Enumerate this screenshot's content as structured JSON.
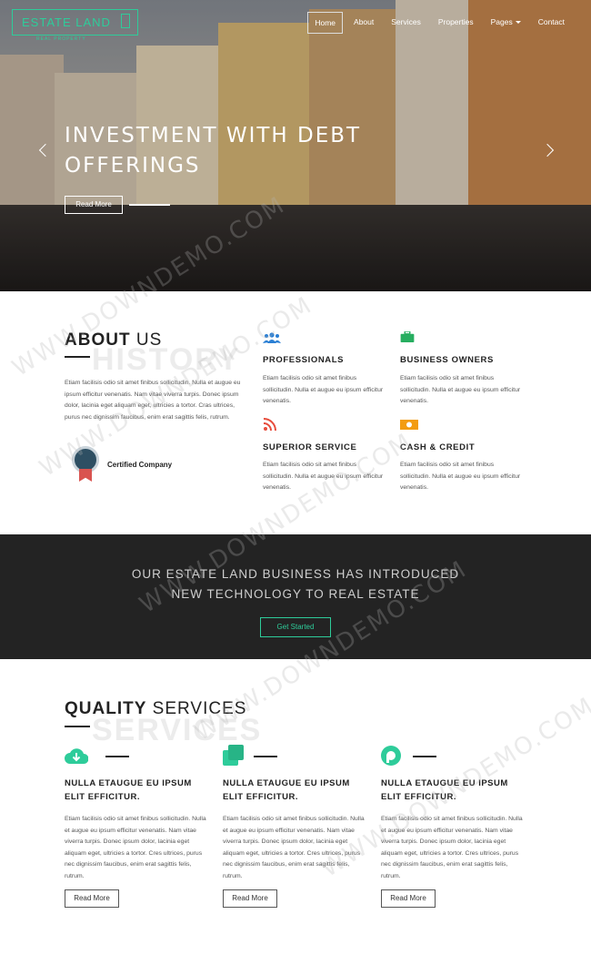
{
  "header": {
    "logo": "ESTATE LAND",
    "logo_sub": "REAL PROPERTY",
    "nav": [
      "Home",
      "About",
      "Services",
      "Properties",
      "Pages",
      "Contact"
    ]
  },
  "hero": {
    "title": "INVESTMENT WITH DEBT OFFERINGS",
    "button": "Read More"
  },
  "about": {
    "title_bold": "ABOUT",
    "title_light": "US",
    "ghost": "HISTORY",
    "text": "Etiam facilisis odio sit amet finibus sollicitudin. Nulla et augue eu ipsum efficitur venenatis. Nam vitae viverra turpis. Donec ipsum dolor, lacinia eget aliquam eget, ultricies a tortor. Cras ultrices, purus nec dignissim faucibus, enim erat sagittis felis, rutrum.",
    "certified": "Certified Company",
    "features": [
      {
        "title": "PROFESSIONALS",
        "icon": "users-icon",
        "text": "Etiam facilisis odio sit amet finibus sollicitudin. Nulla et augue eu ipsum efficitur venenatis."
      },
      {
        "title": "BUSINESS OWNERS",
        "icon": "briefcase-icon",
        "text": "Etiam facilisis odio sit amet finibus sollicitudin. Nulla et augue eu ipsum efficitur venenatis."
      },
      {
        "title": "SUPERIOR SERVICE",
        "icon": "rss-icon",
        "text": "Etiam facilisis odio sit amet finibus sollicitudin. Nulla et augue eu ipsum efficitur venenatis."
      },
      {
        "title": "CASH & CREDIT",
        "icon": "cash-icon",
        "text": "Etiam facilisis odio sit amet finibus sollicitudin. Nulla et augue eu ipsum efficitur venenatis."
      }
    ]
  },
  "cta": {
    "line1": "OUR ESTATE LAND BUSINESS HAS INTRODUCED",
    "line2": "NEW TECHNOLOGY TO REAL ESTATE",
    "button": "Get Started"
  },
  "services": {
    "title_bold": "QUALITY",
    "title_light": "SERVICES",
    "ghost": "SERVICES",
    "items": [
      {
        "icon": "cloud-download-icon",
        "title": "NULLA ETAUGUE EU IPSUM ELIT EFFICITUR.",
        "text": "Etiam facilisis odio sit amet finibus sollicitudin. Nulla et augue eu ipsum efficitur venenatis. Nam vitae viverra turpis. Donec ipsum dolor, lacinia eget aliquam eget, ultricies a tortor. Cres ultrices, purus nec dignissim faucibus, enim erat sagittis felis, rutrum.",
        "button": "Read More"
      },
      {
        "icon": "copy-icon",
        "title": "NULLA ETAUGUE EU IPSUM ELIT EFFICITUR.",
        "text": "Etiam facilisis odio sit amet finibus sollicitudin. Nulla et augue eu ipsum efficitur venenatis. Nam vitae viverra turpis. Donec ipsum dolor, lacinia eget aliquam eget, ultricies a tortor. Cres ultrices, purus nec dignissim faucibus, enim erat sagittis felis, rutrum.",
        "button": "Read More"
      },
      {
        "icon": "circle-play-icon",
        "title": "NULLA ETAUGUE EU IPSUM ELIT EFFICITUR.",
        "text": "Etiam facilisis odio sit amet finibus sollicitudin. Nulla et augue eu ipsum efficitur venenatis. Nam vitae viverra turpis. Donec ipsum dolor, lacinia eget aliquam eget, ultricies a tortor. Cres ultrices, purus nec dignissim faucibus, enim erat sagittis felis, rutrum.",
        "button": "Read More"
      }
    ]
  },
  "watermark": "WWW.DOWNDEMO.COM",
  "colors": {
    "accent": "#2ecc9a",
    "dark": "#232323",
    "text": "#555555"
  }
}
